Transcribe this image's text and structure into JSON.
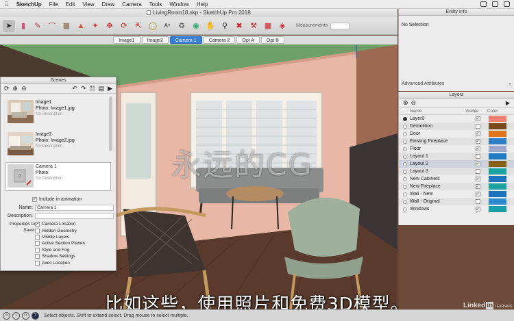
{
  "menubar": {
    "app": "SketchUp",
    "items": [
      "File",
      "Edit",
      "View",
      "Draw",
      "Camera",
      "Tools",
      "Window",
      "Help"
    ]
  },
  "window": {
    "title": "LivingRoom18.skp - SketchUp Pro 2018"
  },
  "toolbar": {
    "tools": [
      "select-icon",
      "eraser-icon",
      "pencil-icon",
      "arc-icon",
      "rectangle-icon",
      "push-pull-icon",
      "follow-me-icon",
      "rotate-icon",
      "scale-icon",
      "tape-measure-icon",
      "text-icon",
      "paint-bucket-icon",
      "orbit-icon",
      "pan-icon",
      "zoom-icon",
      "zoom-extents-icon",
      "warehouse-icon",
      "extension-icon",
      "layout-icon"
    ],
    "measurements_label": "Measurements"
  },
  "scene_tabs": [
    "Image1",
    "Image2",
    "Camera 1",
    "Camera 2",
    "Opt A",
    "Opt B"
  ],
  "entity_info": {
    "title": "Entity Info",
    "selection": "No Selection",
    "advanced": "Advanced Attributes"
  },
  "layers": {
    "title": "Layers",
    "col_name": "Name",
    "col_visible": "Visible",
    "col_color": "Color",
    "rows": [
      {
        "name": "Layer0",
        "visible": true,
        "color": "#f08070",
        "active": true
      },
      {
        "name": "Demolition",
        "visible": false,
        "color": "#7a4a1a"
      },
      {
        "name": "Door",
        "visible": true,
        "color": "#e2741e"
      },
      {
        "name": "Existing Fireplace",
        "visible": true,
        "color": "#2f7ec8"
      },
      {
        "name": "Floor",
        "visible": true,
        "color": "#9aa8cc"
      },
      {
        "name": "Layout 1",
        "visible": false,
        "color": "#1f7bc2"
      },
      {
        "name": "Layout 2",
        "visible": true,
        "color": "#866219"
      },
      {
        "name": "Layout 3",
        "visible": false,
        "color": "#19a2a2"
      },
      {
        "name": "New Cabinets",
        "visible": true,
        "color": "#1d74bd"
      },
      {
        "name": "New Fireplace",
        "visible": true,
        "color": "#19a2a2"
      },
      {
        "name": "Wall - New",
        "visible": true,
        "color": "#1e72bb"
      },
      {
        "name": "Wall - Original",
        "visible": false,
        "color": "#2a8ad2"
      },
      {
        "name": "Windows",
        "visible": true,
        "color": "#19a0a8"
      }
    ]
  },
  "scenes": {
    "title": "Scenes",
    "items": [
      {
        "name": "Image1",
        "photo": "Photo: Image1.jpg",
        "desc": "No Description"
      },
      {
        "name": "Image2",
        "photo": "Photo: Image2.jpg",
        "desc": "No Description"
      },
      {
        "name": "Camera 1",
        "photo": "Photo:",
        "desc": "No Description"
      }
    ],
    "include_label": "Include in animation",
    "name_label": "Name:",
    "name_value": "Camera 1",
    "description_label": "Description:",
    "properties_label": "Properties to",
    "save_label": "Save:",
    "properties": [
      {
        "label": "Camera Location",
        "checked": true
      },
      {
        "label": "Hidden Geometry",
        "checked": false
      },
      {
        "label": "Visible Layers",
        "checked": false
      },
      {
        "label": "Active Section Planes",
        "checked": false
      },
      {
        "label": "Style and Fog",
        "checked": false
      },
      {
        "label": "Shadow Settings",
        "checked": false
      },
      {
        "label": "Axes Location",
        "checked": false
      }
    ]
  },
  "status": {
    "text": "Select objects. Shift to extend select. Drag mouse to select multiple."
  },
  "overlay": {
    "subtitle": "比如这些，使用照片和免费3D模型。",
    "watermark": "永远的CG",
    "linkedin_text": "Linked",
    "linkedin_in": "in",
    "linkedin_sub": "LEARNING"
  }
}
